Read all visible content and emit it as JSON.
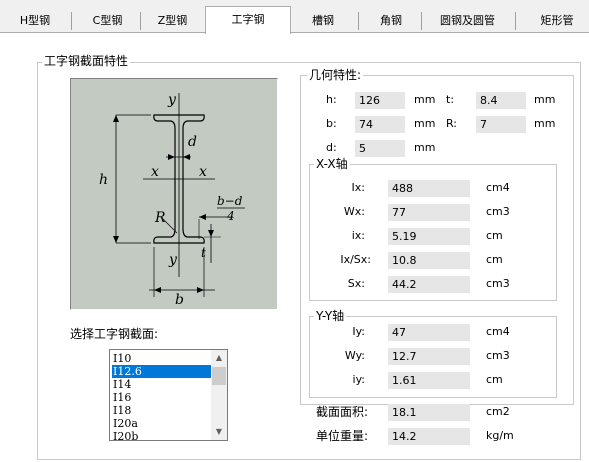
{
  "tabs": [
    {
      "label": "H型钢"
    },
    {
      "label": "C型钢"
    },
    {
      "label": "Z型钢"
    },
    {
      "label": "工字钢"
    },
    {
      "label": "槽钢"
    },
    {
      "label": "角钢"
    },
    {
      "label": "圆钢及圆管"
    },
    {
      "label": "矩形管"
    }
  ],
  "section_group": {
    "title": "工字钢截面特性"
  },
  "figure": {
    "labels": {
      "y_top": "y",
      "y_bottom": "y",
      "x_left": "x",
      "x_right": "x",
      "h": "h",
      "d": "d",
      "t": "t",
      "R": "R",
      "b": "b",
      "frac_num": "b−d",
      "frac_den": "4"
    }
  },
  "selector": {
    "label": "选择工字钢截面:",
    "items": [
      "I10",
      "I12.6",
      "I14",
      "I16",
      "I18",
      "I20a",
      "I20b"
    ],
    "selected": "I12.6"
  },
  "geometry": {
    "title": "几何特性:",
    "h": {
      "label": "h:",
      "value": "126",
      "unit": "mm"
    },
    "t": {
      "label": "t:",
      "value": "8.4",
      "unit": "mm"
    },
    "b": {
      "label": "b:",
      "value": "74",
      "unit": "mm"
    },
    "R": {
      "label": "R:",
      "value": "7",
      "unit": "mm"
    },
    "d": {
      "label": "d:",
      "value": "5",
      "unit": "mm"
    }
  },
  "xx_axis": {
    "title": "X-X轴",
    "Ix": {
      "label": "Ix:",
      "value": "488",
      "unit": "cm4"
    },
    "Wx": {
      "label": "Wx:",
      "value": "77",
      "unit": "cm3"
    },
    "ix": {
      "label": "ix:",
      "value": "5.19",
      "unit": "cm"
    },
    "IxSx": {
      "label": "Ix/Sx:",
      "value": "10.8",
      "unit": "cm"
    },
    "Sx": {
      "label": "Sx:",
      "value": "44.2",
      "unit": "cm3"
    }
  },
  "yy_axis": {
    "title": "Y-Y轴",
    "Iy": {
      "label": "Iy:",
      "value": "47",
      "unit": "cm4"
    },
    "Wy": {
      "label": "Wy:",
      "value": "12.7",
      "unit": "cm3"
    },
    "iy": {
      "label": "iy:",
      "value": "1.61",
      "unit": "cm"
    }
  },
  "totals": {
    "area": {
      "label": "截面面积:",
      "value": "18.1",
      "unit": "cm2"
    },
    "weight": {
      "label": "单位重量:",
      "value": "14.2",
      "unit": "kg/m"
    }
  },
  "colors": {
    "selection": "#0078d7",
    "figure_bg": "#c2cac2",
    "value_bg": "#e6e6e6"
  }
}
